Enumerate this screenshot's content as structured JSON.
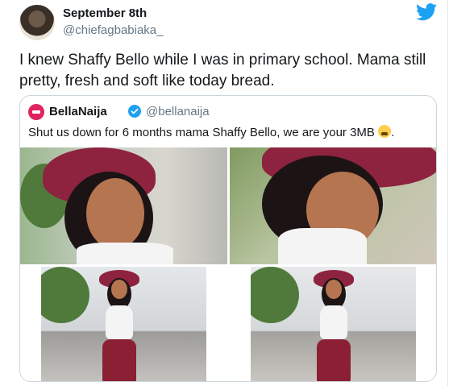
{
  "tweet": {
    "date_label": "September 8th",
    "handle": "@chiefagbabiaka_",
    "text": "I knew Shaffy Bello while I was in primary school. Mama still pretty, fresh and soft like today bread."
  },
  "quoted": {
    "name": "BellaNaija",
    "handle": "@bellanaija",
    "text": "Shut us down for 6 months mama Shaffy Bello, we are your 3MB",
    "text_suffix": "."
  },
  "icons": {
    "brand": "twitter-bird-icon",
    "verified": "verified-badge-icon",
    "emoji": "weary-face-emoji"
  },
  "colors": {
    "twitter_blue": "#1da1f2",
    "text_primary": "#14171a",
    "text_secondary": "#657786",
    "border": "#ccd6dd",
    "brand_red": "#e0245e"
  }
}
